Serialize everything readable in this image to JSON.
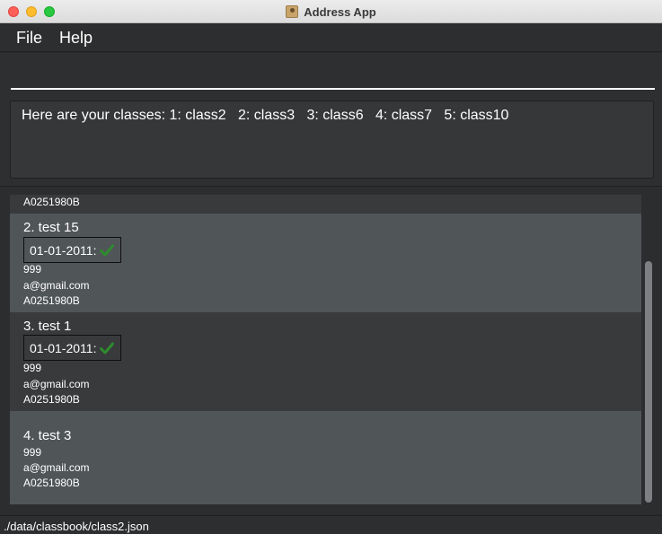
{
  "window": {
    "title": "Address App"
  },
  "menu": {
    "file": "File",
    "help": "Help"
  },
  "command": {
    "value": "",
    "placeholder": ""
  },
  "result": {
    "text": "Here are your classes: 1: class2   2: class3   3: class6   4: class7   5: class10"
  },
  "partial_card": {
    "id": "A0251980B"
  },
  "cards": [
    {
      "name": "2.  test 15",
      "date": "01-01-2011:",
      "phone": "999",
      "email": "a@gmail.com",
      "id": "A0251980B"
    },
    {
      "name": "3.  test 1",
      "date": "01-01-2011:",
      "phone": "999",
      "email": "a@gmail.com",
      "id": "A0251980B"
    },
    {
      "name": "4.  test 3",
      "phone": "999",
      "email": "a@gmail.com",
      "id": "A0251980B"
    }
  ],
  "status": {
    "path": "./data/classbook/class2.json"
  },
  "colors": {
    "check": "#2e8b2e",
    "card_light": "#505558",
    "card_dark": "#383a3c"
  }
}
